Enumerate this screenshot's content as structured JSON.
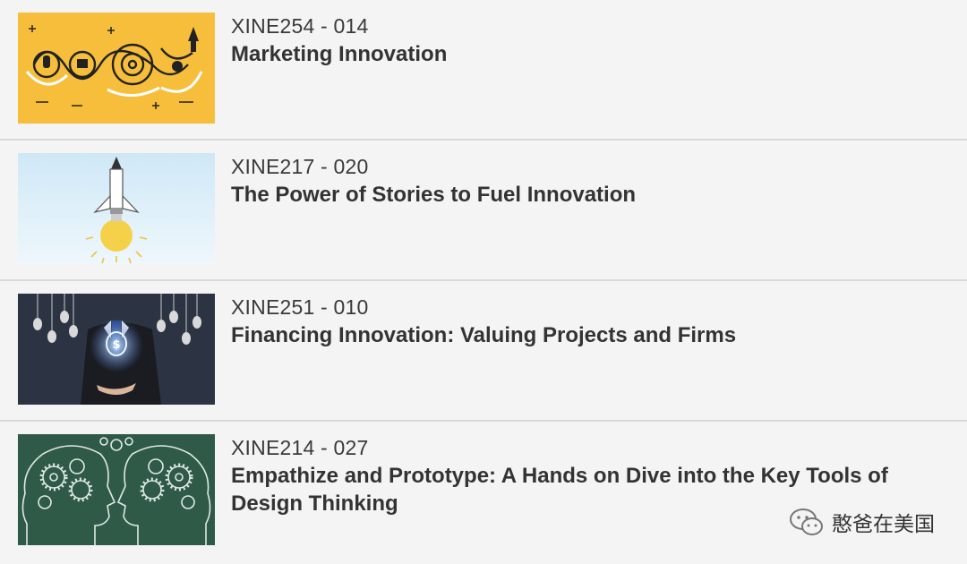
{
  "courses": [
    {
      "code": "XINE254 - 014",
      "title": "Marketing Innovation",
      "thumbnail_icon": "marketing-doodle-icon",
      "thumbnail_color": "#f7be3c"
    },
    {
      "code": "XINE217 - 020",
      "title": "The Power of Stories to Fuel Innovation",
      "thumbnail_icon": "pencil-rocket-lightbulb-icon",
      "thumbnail_color": "#dbeffa"
    },
    {
      "code": "XINE251 - 010",
      "title": "Financing Innovation: Valuing Projects and Firms",
      "thumbnail_icon": "businessman-dollar-bulb-icon",
      "thumbnail_color": "#2c3444"
    },
    {
      "code": "XINE214 - 027",
      "title": "Empathize and Prototype: A Hands on Dive into the Key Tools of Design Thinking",
      "thumbnail_icon": "heads-gears-chalkboard-icon",
      "thumbnail_color": "#2f5a47"
    }
  ],
  "watermark": {
    "text": "憨爸在美国",
    "icon": "wechat-icon"
  }
}
